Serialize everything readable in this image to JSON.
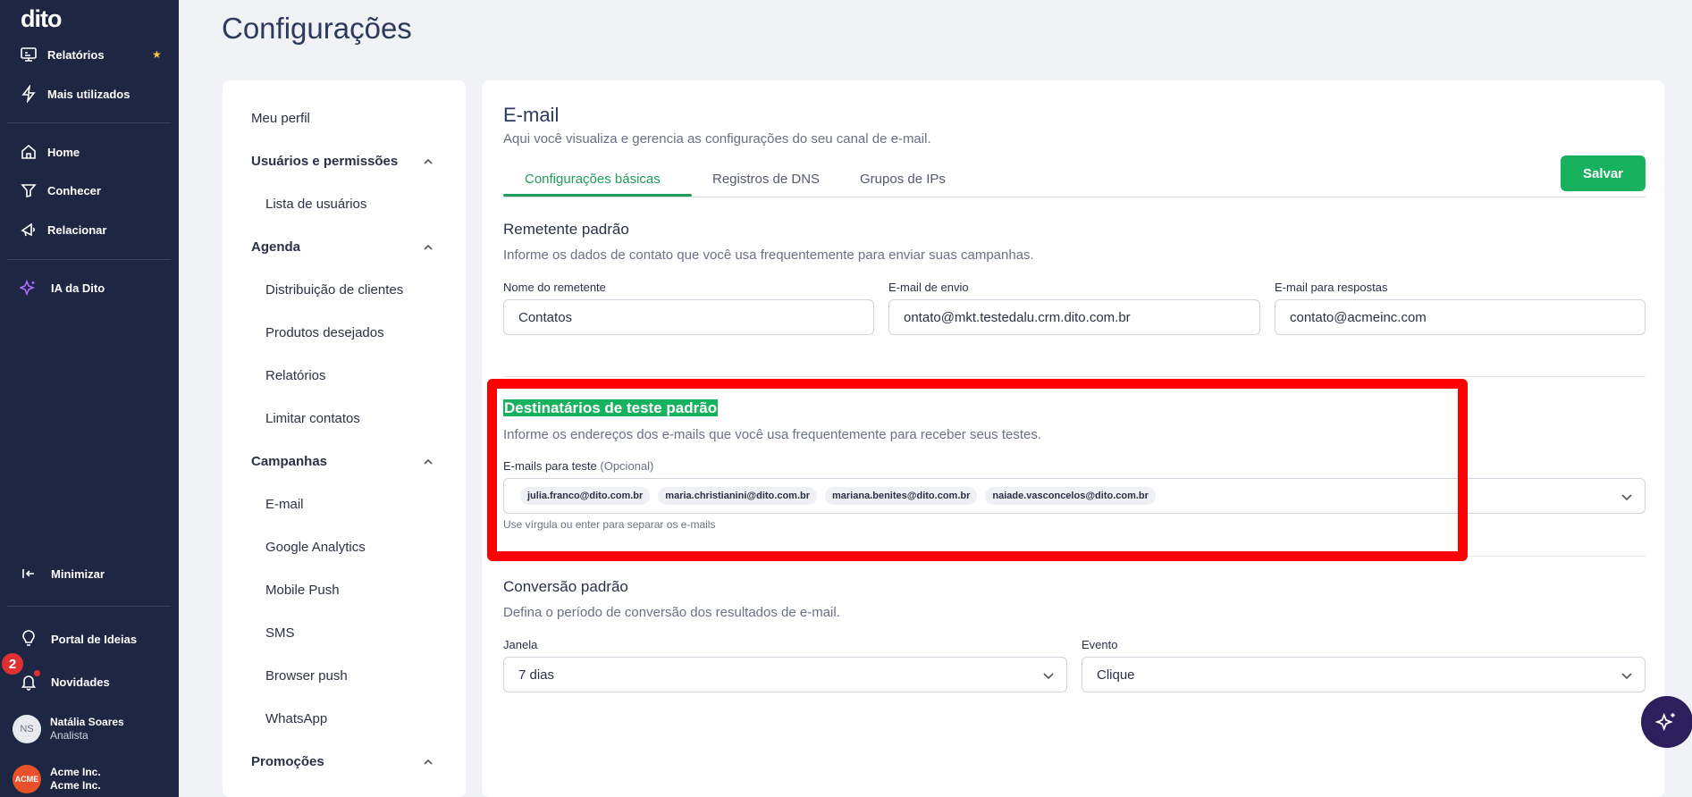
{
  "sidebar": {
    "logo": "dito",
    "items": [
      {
        "label": "Relatórios",
        "icon": "reports-icon"
      },
      {
        "label": "Mais utilizados",
        "icon": "lightning-icon"
      },
      {
        "label": "Home",
        "icon": "home-icon"
      },
      {
        "label": "Conhecer",
        "icon": "filter-icon"
      },
      {
        "label": "Relacionar",
        "icon": "megaphone-icon"
      },
      {
        "label": "IA da Dito",
        "icon": "sparkle-icon"
      },
      {
        "label": "Minimizar",
        "icon": "collapse-icon"
      },
      {
        "label": "Portal de Ideias",
        "icon": "lightbulb-icon"
      },
      {
        "label": "Novidades",
        "icon": "bell-icon"
      }
    ],
    "notification_count": "2",
    "user": {
      "initials": "NS",
      "name": "Natália Soares",
      "role": "Analista"
    },
    "company": {
      "logo_text": "ACME",
      "name": "Acme Inc.",
      "sub": "Acme Inc."
    }
  },
  "page": {
    "title": "Configurações"
  },
  "settings_menu": {
    "meu_perfil": "Meu perfil",
    "groups": [
      {
        "label": "Usuários e permissões",
        "items": [
          "Lista de usuários"
        ]
      },
      {
        "label": "Agenda",
        "items": [
          "Distribuição de clientes",
          "Produtos desejados",
          "Relatórios",
          "Limitar contatos"
        ]
      },
      {
        "label": "Campanhas",
        "items": [
          "E-mail",
          "Google Analytics",
          "Mobile Push",
          "SMS",
          "Browser push",
          "WhatsApp"
        ]
      },
      {
        "label": "Promoções",
        "items": []
      }
    ]
  },
  "email": {
    "title": "E-mail",
    "subtitle": "Aqui você visualiza e gerencia as configurações do seu canal de e-mail.",
    "tabs": [
      "Configurações básicas",
      "Registros de DNS",
      "Grupos de IPs"
    ],
    "save_label": "Salvar",
    "sender": {
      "title": "Remetente padrão",
      "subtitle": "Informe os dados de contato que você usa frequentemente para enviar suas campanhas.",
      "name_label": "Nome do remetente",
      "name_value": "Contatos",
      "from_label": "E-mail de envio",
      "from_value": "ontato@mkt.testedalu.crm.dito.com.br",
      "reply_label": "E-mail para respostas",
      "reply_value": "contato@acmeinc.com"
    },
    "test_recipients": {
      "title": "Destinatários de teste padrão",
      "subtitle": "Informe os endereços dos e-mails que você usa frequentemente para receber seus testes.",
      "label": "E-mails para teste",
      "optional": "(Opcional)",
      "emails": [
        "julia.franco@dito.com.br",
        "maria.christianini@dito.com.br",
        "mariana.benites@dito.com.br",
        "naiade.vasconcelos@dito.com.br"
      ],
      "hint": "Use vírgula ou enter para separar os e-mails"
    },
    "conversion": {
      "title": "Conversão padrão",
      "subtitle": "Defina o período de conversão dos resultados de e-mail.",
      "window_label": "Janela",
      "window_value": "7 dias",
      "event_label": "Evento",
      "event_value": "Clique"
    }
  },
  "colors": {
    "sidebar": "#1d2743",
    "accent": "#18b15e",
    "highlight_box": "#ff0000"
  }
}
